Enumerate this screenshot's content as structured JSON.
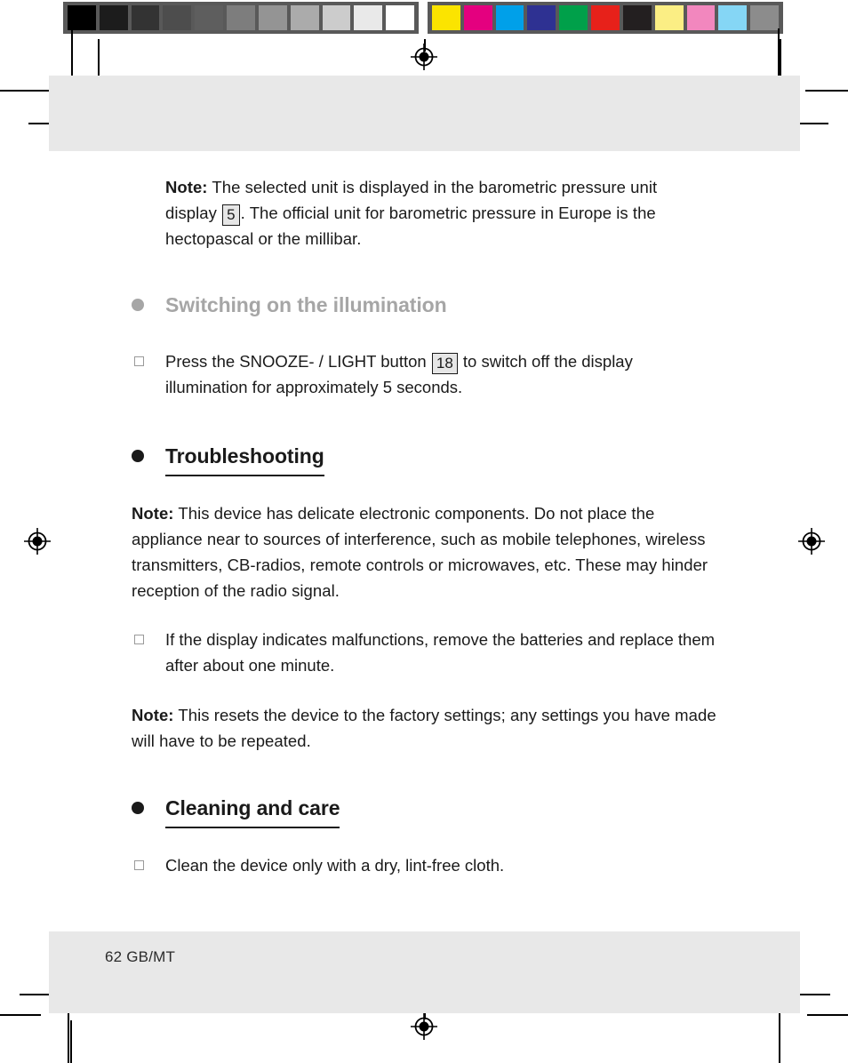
{
  "page": {
    "folio": "62  GB/MT",
    "page_number": "62",
    "language_code": "GB/MT"
  },
  "calibration": {
    "grayscale_label": "grayscale-calibration-strip",
    "grayscale_patches": [
      "#000000",
      "#1c1c1c",
      "#333333",
      "#4d4d4d",
      "#5e5e5e",
      "#7d7d7d",
      "#949494",
      "#ababab",
      "#cccccc",
      "#e9e9e9",
      "#ffffff"
    ],
    "color_label": "color-calibration-strip",
    "color_patches": [
      "#fbe400",
      "#e4007f",
      "#00a0e9",
      "#2e3192",
      "#00a04a",
      "#e7211a",
      "#231f20",
      "#fbee84",
      "#f287be",
      "#85d6f5",
      "#8c8c8c"
    ]
  },
  "content": {
    "note_unit": {
      "label": "Note:",
      "text_before_ref": "The selected unit is displayed in the barometric pressure unit display",
      "ref": "5",
      "text_after_ref": ". The official unit for barometric pressure in Europe is the hectopascal or the millibar."
    },
    "heading_illumination": "Switching on the illumination",
    "bullet_illumination": {
      "text_before_ref": "Press the SNOOZE- / LIGHT button",
      "ref": "18",
      "text_after_ref": "to switch off the display illumination for approximately 5 seconds."
    },
    "heading_troubleshooting": "Troubleshooting",
    "note_interference": {
      "label": "Note:",
      "text": "This device has delicate electronic components. Do not place the appliance near to sources of interference, such as mobile telephones, wireless transmitters, CB-radios, remote controls or microwaves, etc. These may hinder reception of the radio signal."
    },
    "bullet_malfunction": "If the display indicates malfunctions, remove the batteries and replace them after about one minute.",
    "note_reset": {
      "label": "Note:",
      "text": "This resets the device to the factory settings; any settings you have made will have to be repeated."
    },
    "heading_cleaning": "Cleaning and care",
    "bullet_cleaning": "Clean the device only with a dry, lint-free cloth."
  }
}
